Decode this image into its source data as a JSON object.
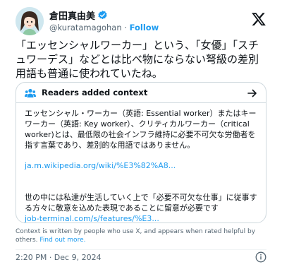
{
  "author": {
    "display_name": "倉田真由美",
    "handle": "@kuratamagohan",
    "separator": " · ",
    "follow_label": "Follow",
    "verified": true
  },
  "tweet": {
    "text": "「エッセンシャルワーカー」という、「女優」「スチュワーデス」などとは比べ物にならない弩級の差別用語も普通に使われていたね。"
  },
  "community_note": {
    "title": "Readers added context",
    "body_1": "エッセンシャル・ワーカー（英語: Essential worker）またはキーワーカー（英語: Key worker）、クリティカルワーカー（critical worker)とは、最低限の社会インフラ維持に必要不可欠な労働者を指す言葉であり、差別的な用語ではありません。",
    "link_1": "ja.m.wikipedia.org/wiki/%E3%82%A8...",
    "body_2": "世の中には私達が生活していく上で「必要不可欠な仕事」に従事する方々に敬意を込めた表現であることに留意が必要です",
    "link_2": "job-terminal.com/s/features/%E3...",
    "disclaimer": "Context is written by people who use X, and appears when rated helpful by others. ",
    "find_out_more": "Find out more."
  },
  "timestamp": "2:20 PM · Dec 9, 2024",
  "colors": {
    "accent": "#1d9bf0",
    "text": "#0f1419",
    "secondary": "#536471",
    "border": "#cfd9de"
  },
  "icons": [
    "verified-badge-icon",
    "x-logo-icon",
    "people-icon",
    "arrow-right-icon",
    "info-icon"
  ]
}
